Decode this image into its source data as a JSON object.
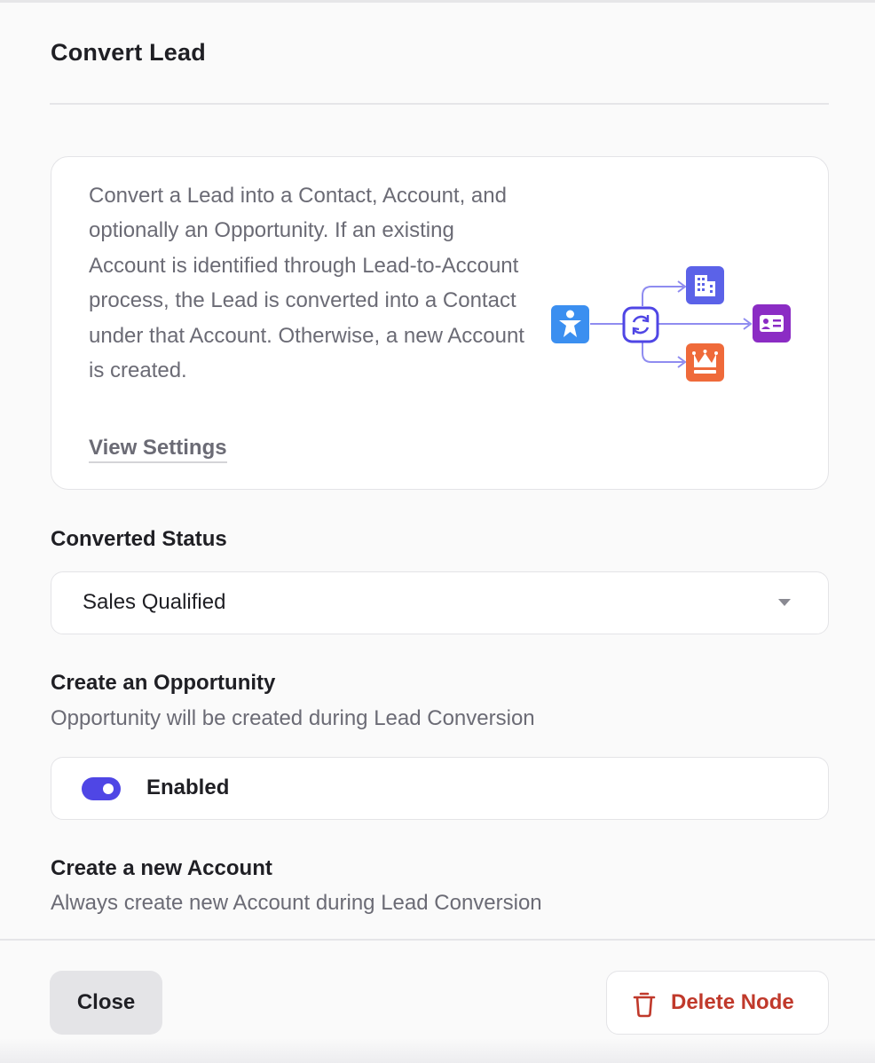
{
  "panel": {
    "title": "Convert Lead"
  },
  "info_card": {
    "description": "Convert a Lead into a Contact, Account, and optionally an Opportunity. If an existing Account is identified through Lead-to-Account process, the Lead is converted into a Contact under that Account. Otherwise, a new Account is created.",
    "view_settings_label": "View Settings",
    "diagram_icons": [
      "lead-person-icon",
      "convert-sync-icon",
      "account-building-icon",
      "contact-card-icon",
      "opportunity-crown-icon"
    ],
    "colors": {
      "lead": "#3b8ff0",
      "convert": "#4f46e5",
      "account": "#5b62e8",
      "contact": "#8b2cc4",
      "opportunity": "#ef6a3a",
      "arrow": "#8f8cf0"
    }
  },
  "converted_status": {
    "label": "Converted Status",
    "value": "Sales Qualified"
  },
  "create_opportunity": {
    "label": "Create an Opportunity",
    "description": "Opportunity will be created during Lead Conversion",
    "toggle_label": "Enabled",
    "enabled": true
  },
  "create_account": {
    "label": "Create a new Account",
    "description": "Always create new Account during Lead Conversion"
  },
  "footer": {
    "close_label": "Close",
    "delete_label": "Delete Node"
  },
  "colors": {
    "accent": "#4f46e5",
    "danger": "#c0392b"
  }
}
